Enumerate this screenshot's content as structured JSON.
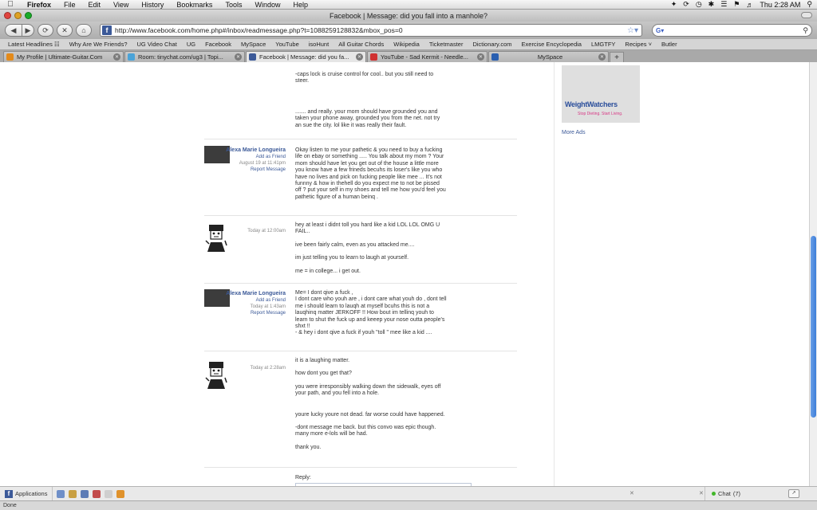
{
  "menubar": {
    "app": "Firefox",
    "items": [
      "File",
      "Edit",
      "View",
      "History",
      "Bookmarks",
      "Tools",
      "Window",
      "Help"
    ],
    "clock": "Thu 2:28 AM"
  },
  "window": {
    "title": "Facebook | Message: did you fall into a manhole?"
  },
  "toolbar": {
    "url": "http://www.facebook.com/home.php#/inbox/readmessage.php?t=1088259128832&mbox_pos=0"
  },
  "bookmarks": [
    "Latest Headlines ☷",
    "Why Are We Friends?",
    "UG Video Chat",
    "UG",
    "Facebook",
    "MySpace",
    "YouTube",
    "isoHunt",
    "All Guitar Chords",
    "Wikipedia",
    "Ticketmaster",
    "Dictionary.com",
    "Exercise Encyclopedia",
    "LMGTFY",
    "Recipes ˅",
    "Butler"
  ],
  "tabs": [
    {
      "label": "My Profile | Ultimate-Guitar.Com",
      "color": "#e38a1a"
    },
    {
      "label": "Room: tinychat.com/ug3 | Topi...",
      "color": "#4aa3d8"
    },
    {
      "label": "Facebook | Message: did you fa...",
      "color": "#3b5998"
    },
    {
      "label": "YouTube - Sad Kermit - Needle...",
      "color": "#d03030"
    },
    {
      "label": "MySpace",
      "color": "#2a5fb0"
    }
  ],
  "messages": [
    {
      "sender": "",
      "time": "",
      "paragraphs": [
        "-caps lock is cruise control for cool.. but you still need to steer.",
        "",
        "....... and really. your mom should have grounded you and taken your phone away, grounded you from the net. not try an sue the city. lol like it was really their fault."
      ]
    },
    {
      "sender": "Alexa Marie Longueira",
      "add_friend": "Add as Friend",
      "time": "August 19 at 11:41pm",
      "report": "Report Message",
      "paragraphs": [
        "Okay listen to me your pathetic & you need to buy a fucking life on ebay or something ..... You talk about my mom ? Your mom should have let you get out of the house a little more you know have a few frineds becuhs its loser's like you who have no lives and pick on fucking people like mee ... It's not funnny & how in thehell do you expect me to not be pissed off ? put your self in my shoes and tell me how you'd feel you pathetic figure of a human beinq ."
      ]
    },
    {
      "sender": "",
      "time": "Today at 12:00am",
      "paragraphs": [
        "hey at least i didnt toll you hard like a kid LOL LOL OMG U FAIL..",
        "ive been fairly calm, even as you attacked me....",
        "im just telling you to learn to laugh at yourself.",
        "me = in college... i get out."
      ]
    },
    {
      "sender": "Alexa Marie Longueira",
      "add_friend": "Add as Friend",
      "time": "Today at 1:43am",
      "report": "Report Message",
      "paragraphs": [
        "Me= I dont qive a fuck ,",
        "I dont care who youh are , i dont care what youh do , dont tell me i should learn to lauqh at myself bcuhs this is not a lauqhinq matter JERKOFF !! How bout im tellinq youh to learn to shut the fuck up and keeep your nose outta people's shxt !!",
        "- & hey i dont qive a fuck if youh \"toll \" mee like a kid ...."
      ]
    },
    {
      "sender": "",
      "time": "Today at 2:28am",
      "paragraphs": [
        "it is a laughing matter.",
        "how dont you get that?",
        "you were irresponsibly walking down the sidewalk, eyes off your path, and you fell into a hole.",
        "",
        "youre lucky youre not dead. far worse could have happened.",
        "-dont message me back. but this convo was epic though. many more e-lols will be had.",
        "thank you."
      ]
    }
  ],
  "reply": {
    "label": "Reply:"
  },
  "sidebar": {
    "ad_logo": "WeightWatchers",
    "ad_tagline": "Stop Dieting. Start Living.",
    "more_ads": "More Ads"
  },
  "fbbar": {
    "applications": "Applications",
    "chat": "Chat",
    "chat_count": "(7)"
  },
  "statusbar": {
    "text": "Done"
  }
}
